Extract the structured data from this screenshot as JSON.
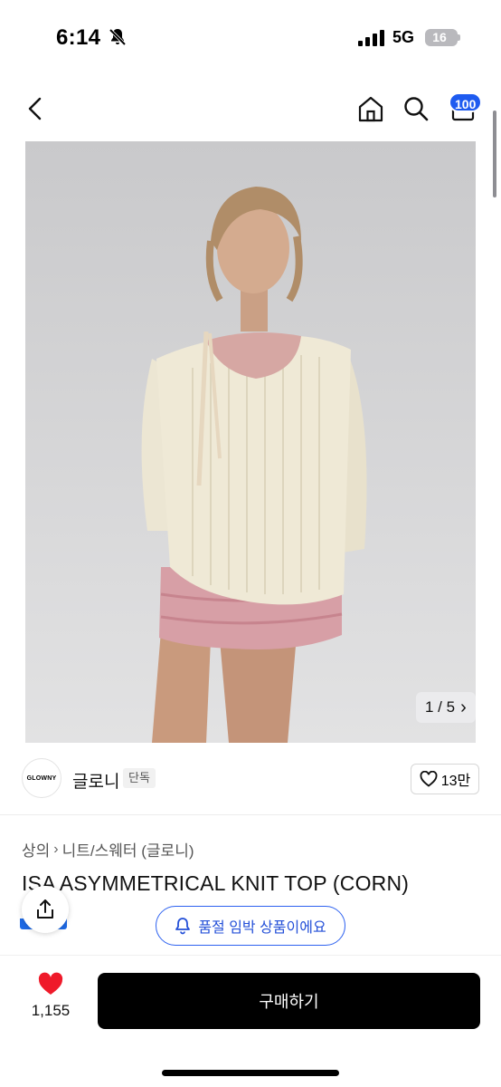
{
  "status_bar": {
    "time": "6:14",
    "network": "5G",
    "battery": "16"
  },
  "header": {
    "cart_count": "100"
  },
  "image": {
    "counter": "1 / 5",
    "next_glyph": "›"
  },
  "brand": {
    "logo_text": "GLOWNY",
    "name": "글로니",
    "badge": "단독",
    "likes": "13만"
  },
  "breadcrumb": {
    "category": "상의",
    "sep": "›",
    "subcategory": "니트/스웨터 (글로니)"
  },
  "product": {
    "title": "ISA ASYMMETRICAL KNIT TOP (CORN)"
  },
  "notice": {
    "low_stock": "품절 임박 상품이에요"
  },
  "bottom_bar": {
    "like_count": "1,155",
    "buy_label": "구매하기"
  },
  "colors": {
    "accent_blue": "#1e5bf0",
    "like_red": "#ef1a2a",
    "buy_black": "#000000"
  }
}
